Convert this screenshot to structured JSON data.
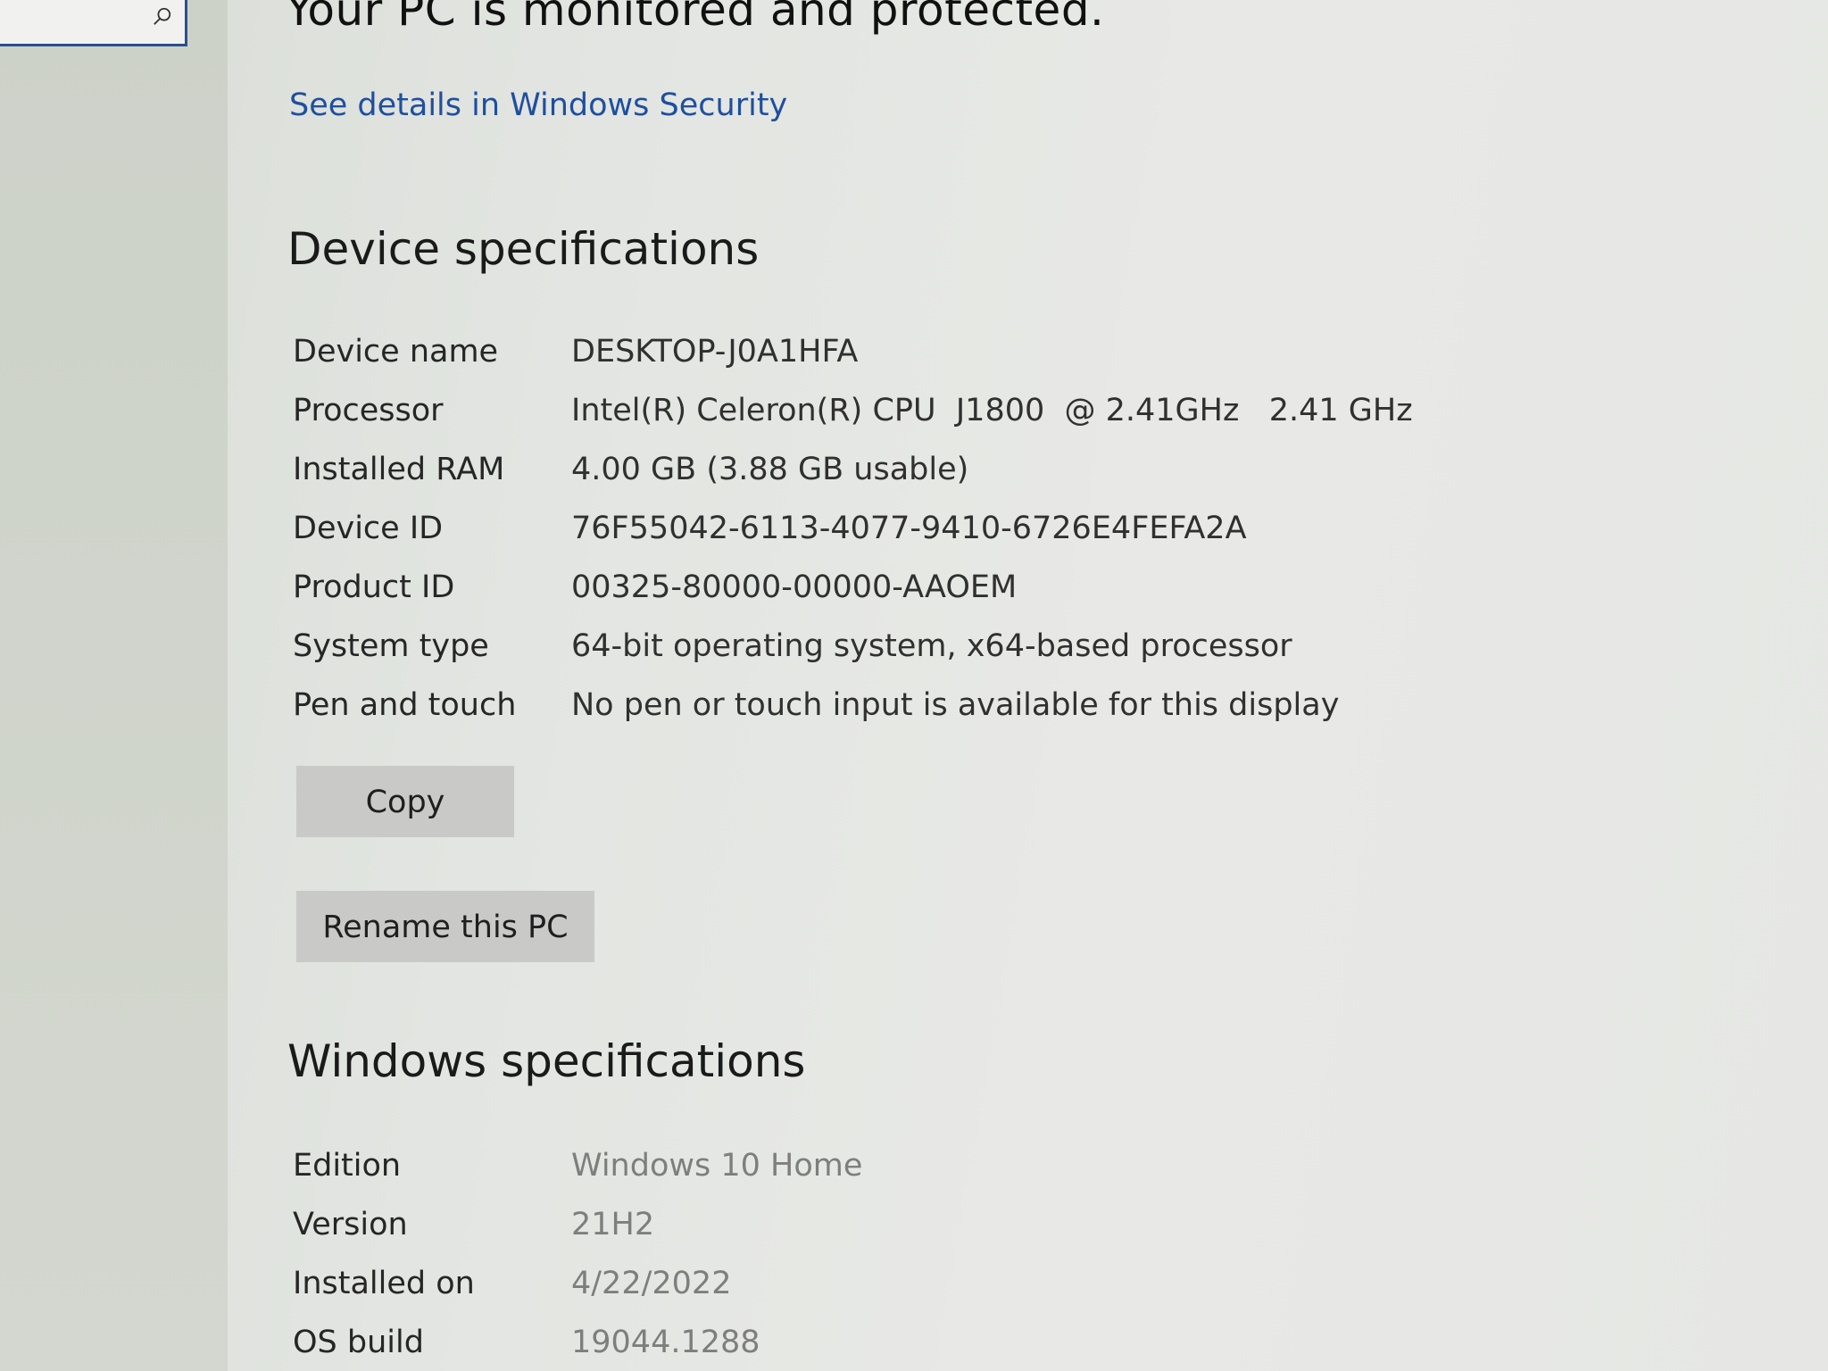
{
  "protection": {
    "title": "Your PC is monitored and protected.",
    "link": "See details in Windows Security"
  },
  "device_specs": {
    "title": "Device specifications",
    "rows": [
      {
        "label": "Device name",
        "value": "DESKTOP-J0A1HFA"
      },
      {
        "label": "Processor",
        "value": "Intel(R) Celeron(R) CPU  J1800  @ 2.41GHz   2.41 GHz"
      },
      {
        "label": "Installed RAM",
        "value": "4.00 GB (3.88 GB usable)"
      },
      {
        "label": "Device ID",
        "value": "76F55042-6113-4077-9410-6726E4FEFA2A"
      },
      {
        "label": "Product ID",
        "value": "00325-80000-00000-AAOEM"
      },
      {
        "label": "System type",
        "value": "64-bit operating system, x64-based processor"
      },
      {
        "label": "Pen and touch",
        "value": "No pen or touch input is available for this display"
      }
    ],
    "copy_button": "Copy",
    "rename_button": "Rename this PC"
  },
  "windows_specs": {
    "title": "Windows specifications",
    "rows": [
      {
        "label": "Edition",
        "value": "Windows 10 Home"
      },
      {
        "label": "Version",
        "value": "21H2"
      },
      {
        "label": "Installed on",
        "value": "4/22/2022"
      },
      {
        "label": "OS build",
        "value": "19044.1288"
      }
    ]
  },
  "icons": {
    "search": "search-icon"
  },
  "colors": {
    "link": "#1f4f9e",
    "button": "#c9cac8",
    "search_border": "#2d4f8f"
  }
}
